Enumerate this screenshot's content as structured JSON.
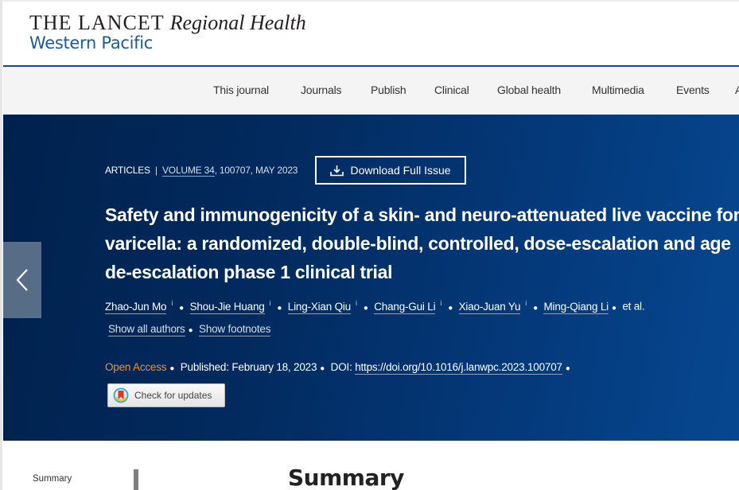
{
  "header": {
    "logo_line1_lancet": "THE LANCET",
    "logo_line1_regional": "Regional Health",
    "logo_line2": "Western Pacific"
  },
  "nav": {
    "items": [
      "This journal",
      "Journals",
      "Publish",
      "Clinical",
      "Global health",
      "Multimedia",
      "Events",
      "A"
    ]
  },
  "article": {
    "type": "ARTICLES",
    "separator": "|",
    "volume_link": "VOLUME 34",
    "volume_rest": ", 100707, MAY 2023",
    "download_label": "Download Full Issue",
    "title": "Safety and immunogenicity of a skin- and neuro-attenuated live vaccine for varicella: a randomized, double-blind, controlled, dose-escalation and age de-escalation phase 1 clinical trial",
    "authors": [
      "Zhao-Jun Mo",
      "Shou-Jie Huang",
      "Ling-Xian Qiu",
      "Chang-Gui Li",
      "Xiao-Juan Yu",
      "Ming-Qiang Li"
    ],
    "info_glyph": "i",
    "et_al": "et al.",
    "show_all_authors": "Show all authors",
    "show_footnotes": "Show footnotes",
    "open_access": "Open Access",
    "published_label": "Published: February 18, 2023",
    "doi_label": "DOI:",
    "doi_url": "https://doi.org/10.1016/j.lanwpc.2023.100707",
    "check_updates": "Check for updates"
  },
  "content": {
    "toc_items": [
      "Summary"
    ],
    "section_heading": "Summary"
  },
  "colors": {
    "brand_blue": "#1f5a96",
    "banner_dark": "#00214d",
    "banner_light": "#064790",
    "open_access": "#e8943a"
  }
}
